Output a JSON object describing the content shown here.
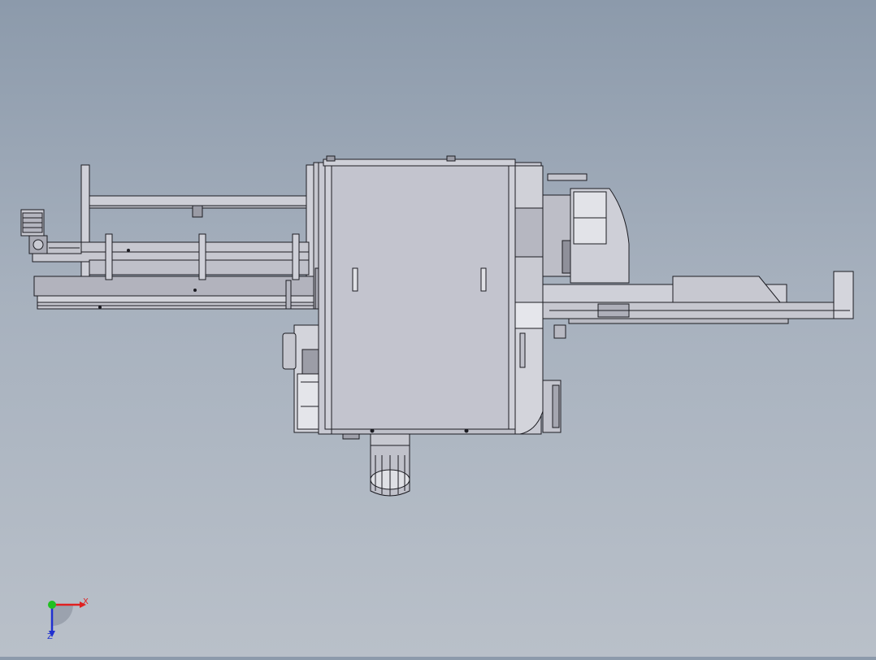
{
  "colors": {
    "background_top": "#8c9aab",
    "background_bottom": "#b9c0c9",
    "body_fill": "#c8c9d2",
    "panel_fill": "#c3c4ce",
    "edge": "#1c1c22",
    "axis_x": "#e02020",
    "axis_y": "#20c020",
    "axis_z": "#2030d0"
  },
  "triad": {
    "x_label": "X",
    "z_label": "Z",
    "y_icon": "y-axis-dot-icon"
  },
  "view": {
    "mode": "shaded-with-edges",
    "orientation": "top"
  }
}
